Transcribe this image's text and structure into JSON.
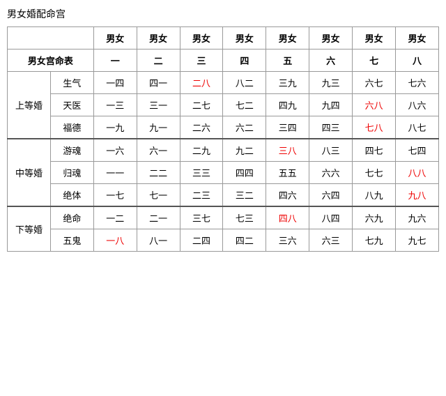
{
  "title": "男女婚配命宫",
  "table": {
    "col_headers": [
      "男女宫命表",
      "男女",
      "男女",
      "男女",
      "男女",
      "男女",
      "男女",
      "男女",
      "男女"
    ],
    "col_headers2": [
      "",
      "一",
      "二",
      "三",
      "四",
      "五",
      "六",
      "七",
      "八"
    ],
    "rows": [
      {
        "group": "上等婚",
        "subrows": [
          {
            "sub": "生气",
            "cells": [
              {
                "text": "一四",
                "red": false
              },
              {
                "text": "四一",
                "red": false
              },
              {
                "text": "二八",
                "red": true
              },
              {
                "text": "八二",
                "red": false
              },
              {
                "text": "三九",
                "red": false
              },
              {
                "text": "九三",
                "red": false
              },
              {
                "text": "六七",
                "red": false
              },
              {
                "text": "七六",
                "red": false
              }
            ]
          },
          {
            "sub": "天医",
            "cells": [
              {
                "text": "一三",
                "red": false
              },
              {
                "text": "三一",
                "red": false
              },
              {
                "text": "二七",
                "red": false
              },
              {
                "text": "七二",
                "red": false
              },
              {
                "text": "四九",
                "red": false
              },
              {
                "text": "九四",
                "red": false
              },
              {
                "text": "六八",
                "red": true
              },
              {
                "text": "八六",
                "red": false
              }
            ]
          },
          {
            "sub": "福德",
            "cells": [
              {
                "text": "一九",
                "red": false
              },
              {
                "text": "九一",
                "red": false
              },
              {
                "text": "二六",
                "red": false
              },
              {
                "text": "六二",
                "red": false
              },
              {
                "text": "三四",
                "red": false
              },
              {
                "text": "四三",
                "red": false
              },
              {
                "text": "七八",
                "red": true
              },
              {
                "text": "八七",
                "red": false
              }
            ]
          }
        ]
      },
      {
        "group": "中等婚",
        "subrows": [
          {
            "sub": "游魂",
            "cells": [
              {
                "text": "一六",
                "red": false
              },
              {
                "text": "六一",
                "red": false
              },
              {
                "text": "二九",
                "red": false
              },
              {
                "text": "九二",
                "red": false
              },
              {
                "text": "三八",
                "red": true
              },
              {
                "text": "八三",
                "red": false
              },
              {
                "text": "四七",
                "red": false
              },
              {
                "text": "七四",
                "red": false
              }
            ]
          },
          {
            "sub": "归魂",
            "cells": [
              {
                "text": "一一",
                "red": false
              },
              {
                "text": "二二",
                "red": false
              },
              {
                "text": "三三",
                "red": false
              },
              {
                "text": "四四",
                "red": false
              },
              {
                "text": "五五",
                "red": false
              },
              {
                "text": "六六",
                "red": false
              },
              {
                "text": "七七",
                "red": false
              },
              {
                "text": "八八",
                "red": true
              }
            ]
          },
          {
            "sub": "绝体",
            "cells": [
              {
                "text": "一七",
                "red": false
              },
              {
                "text": "七一",
                "red": false
              },
              {
                "text": "二三",
                "red": false
              },
              {
                "text": "三二",
                "red": false
              },
              {
                "text": "四六",
                "red": false
              },
              {
                "text": "六四",
                "red": false
              },
              {
                "text": "八九",
                "red": false
              },
              {
                "text": "九八",
                "red": true
              }
            ]
          }
        ]
      },
      {
        "group": "下等婚",
        "subrows": [
          {
            "sub": "绝命",
            "cells": [
              {
                "text": "一二",
                "red": false
              },
              {
                "text": "二一",
                "red": false
              },
              {
                "text": "三七",
                "red": false
              },
              {
                "text": "七三",
                "red": false
              },
              {
                "text": "四八",
                "red": true
              },
              {
                "text": "八四",
                "red": false
              },
              {
                "text": "六九",
                "red": false
              },
              {
                "text": "九六",
                "red": false
              }
            ]
          },
          {
            "sub": "五鬼",
            "cells": [
              {
                "text": "一八",
                "red": true
              },
              {
                "text": "八一",
                "red": false
              },
              {
                "text": "二四",
                "red": false
              },
              {
                "text": "四二",
                "red": false
              },
              {
                "text": "三六",
                "red": false
              },
              {
                "text": "六三",
                "red": false
              },
              {
                "text": "七九",
                "red": false
              },
              {
                "text": "九七",
                "red": false
              }
            ]
          }
        ]
      }
    ]
  }
}
